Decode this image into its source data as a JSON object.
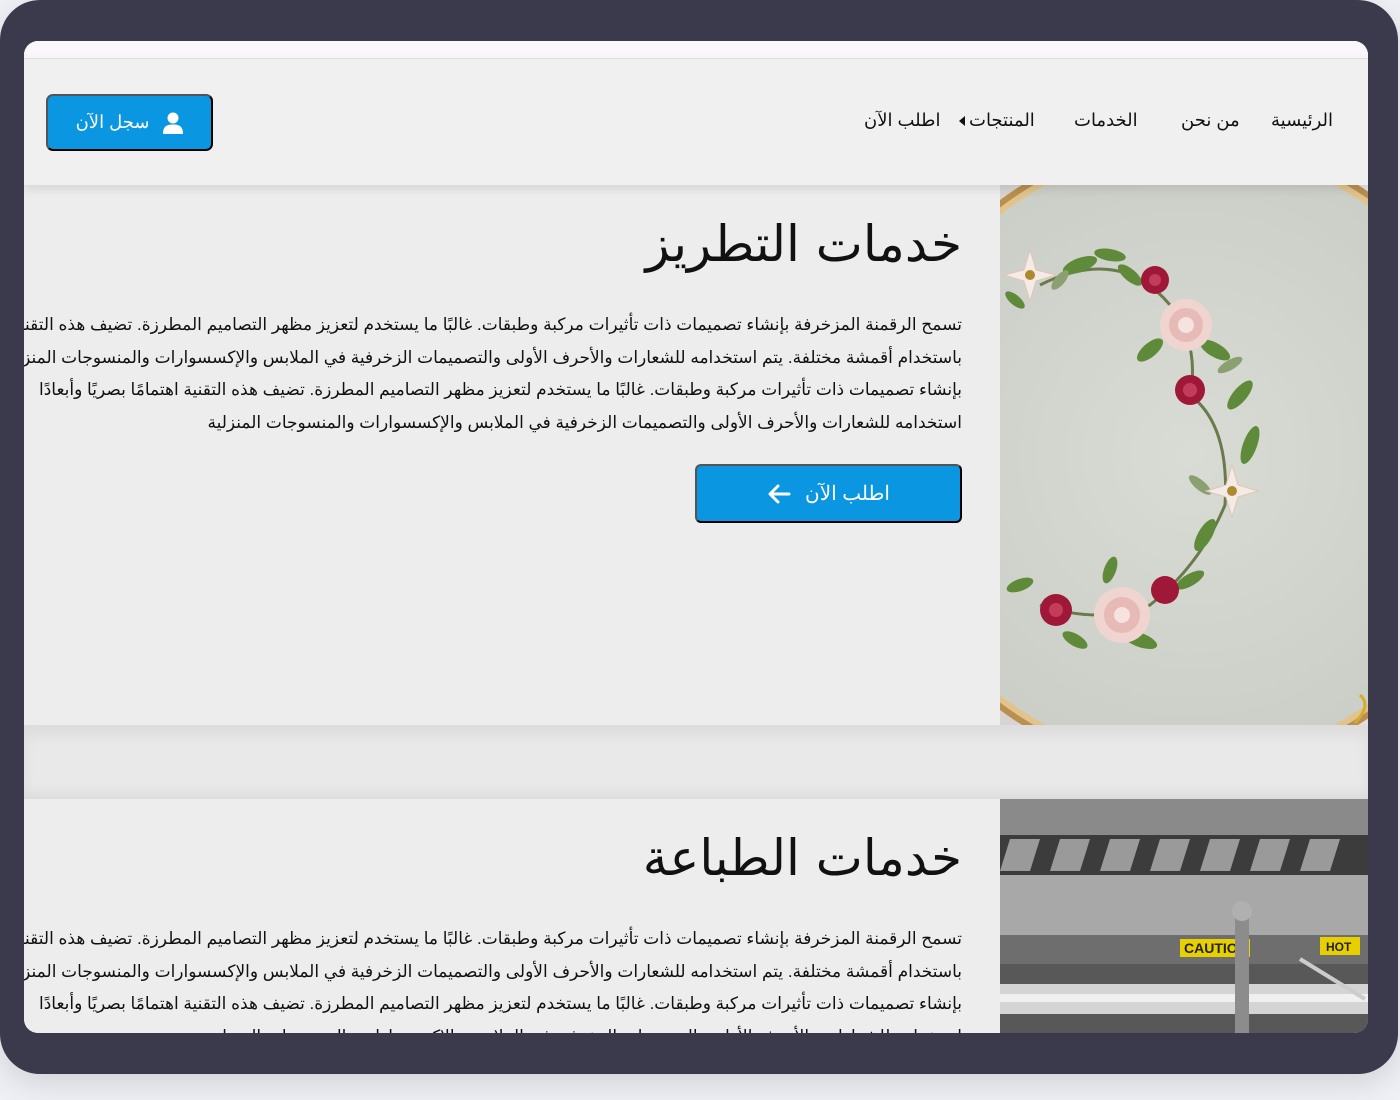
{
  "nav": {
    "items": [
      {
        "label": "الرئيسية"
      },
      {
        "label": "من نحن"
      },
      {
        "label": "الخدمات"
      },
      {
        "label": "المنتجات"
      },
      {
        "label": "اطلب الآن"
      }
    ],
    "register_label": "سجل الآن"
  },
  "sections": [
    {
      "title": "خدمات التطريز",
      "lines": [
        "تسمح الرقمنة المزخرفة بإنشاء تصميمات ذات تأثيرات مركبة وطبقات. غالبًا ما يستخدم لتعزيز مظهر التصاميم المطرزة. تضيف هذه التقنية",
        "باستخدام أقمشة مختلفة. يتم استخدامه للشعارات والأحرف الأولى والتصميمات الزخرفية في الملابس والإكسسوارات والمنسوجات المنزلية",
        "بإنشاء تصميمات ذات تأثيرات مركبة وطبقات. غالبًا ما يستخدم لتعزيز مظهر التصاميم المطرزة. تضيف هذه التقنية اهتمامًا بصريًا وأبعادًا",
        "استخدامه للشعارات والأحرف الأولى والتصميمات الزخرفية في الملابس والإكسسوارات والمنسوجات المنزلية"
      ],
      "button_label": "اطلب الآن"
    },
    {
      "title": "خدمات الطباعة",
      "lines": [
        "تسمح الرقمنة المزخرفة بإنشاء تصميمات ذات تأثيرات مركبة وطبقات. غالبًا ما يستخدم لتعزيز مظهر التصاميم المطرزة. تضيف هذه التقنية",
        "باستخدام أقمشة مختلفة. يتم استخدامه للشعارات والأحرف الأولى والتصميمات الزخرفية في الملابس والإكسسوارات والمنسوجات المنزلية",
        "بإنشاء تصميمات ذات تأثيرات مركبة وطبقات. غالبًا ما يستخدم لتعزيز مظهر التصاميم المطرزة. تضيف هذه التقنية اهتمامًا بصريًا وأبعادًا",
        "استخدامه للشعارات والأحرف الأولى والتصميمات الزخرفية في الملابس والإكسسوارات والمنسوجات المنزلية"
      ]
    }
  ],
  "images": {
    "embroidery_label_text": "",
    "caution_label": "CAUTION",
    "hot_label": "HOT"
  },
  "colors": {
    "accent": "#0a96e0",
    "frame": "#3a3a4c",
    "background": "#ededed"
  },
  "icons": {
    "register": "user-icon",
    "order": "arrow-left-icon",
    "products": "caret-left-icon"
  }
}
